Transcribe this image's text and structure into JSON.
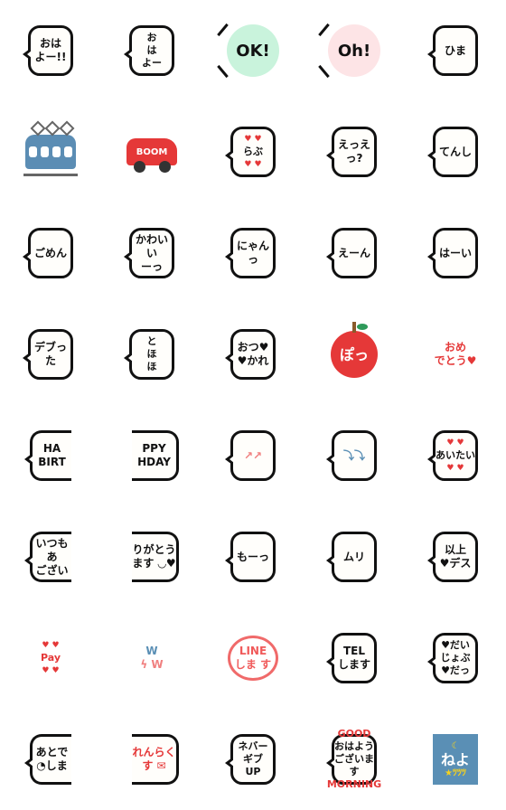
{
  "colors": {
    "ink": "#111111",
    "red": "#e53838",
    "pink": "#f08080",
    "blue": "#5a8fb5",
    "mint": "#c9f3dc",
    "blush": "#fde4e6",
    "yellow": "#f7d21e"
  },
  "emojis": [
    {
      "name": "ohayo-sun",
      "variant": "bubble",
      "lines": [
        "おは",
        "よー!!"
      ],
      "color": "#111111"
    },
    {
      "name": "ohayo-rooster",
      "variant": "bubble",
      "lines": [
        "お",
        "は",
        "よー"
      ],
      "color": "#111111"
    },
    {
      "name": "ok",
      "variant": "circle-green",
      "lines": [
        "OK!"
      ],
      "color": "#111111"
    },
    {
      "name": "oh",
      "variant": "circle-pink",
      "lines": [
        "Oh!"
      ],
      "color": "#111111"
    },
    {
      "name": "hima",
      "variant": "bubble",
      "lines": [
        "ひま"
      ],
      "color": "#111111"
    },
    {
      "name": "train",
      "variant": "train",
      "lines": [],
      "color": "#5a8fb5"
    },
    {
      "name": "car-boom",
      "variant": "car",
      "lines": [
        "BOOM"
      ],
      "color": "#ffffff"
    },
    {
      "name": "rabu",
      "variant": "bubble",
      "lines": [
        "♥ ♥",
        "らぶ",
        "♥ ♥"
      ],
      "color": "#111111"
    },
    {
      "name": "eee",
      "variant": "bubble",
      "lines": [
        "えっえっ?"
      ],
      "color": "#111111"
    },
    {
      "name": "tenshi",
      "variant": "bubble",
      "lines": [
        "てんし"
      ],
      "color": "#111111"
    },
    {
      "name": "gomen",
      "variant": "bubble",
      "lines": [
        "ごめん"
      ],
      "color": "#111111"
    },
    {
      "name": "kawaii",
      "variant": "bubble",
      "lines": [
        "かわいい",
        "ーっ"
      ],
      "color": "#111111"
    },
    {
      "name": "nyan",
      "variant": "bubble",
      "lines": [
        "にゃんっ"
      ],
      "color": "#111111"
    },
    {
      "name": "een",
      "variant": "bubble",
      "lines": [
        "えーん"
      ],
      "color": "#111111"
    },
    {
      "name": "hai",
      "variant": "bubble",
      "lines": [
        "はーい"
      ],
      "color": "#111111"
    },
    {
      "name": "debutta",
      "variant": "bubble",
      "lines": [
        "デブった"
      ],
      "color": "#111111"
    },
    {
      "name": "tohoho",
      "variant": "bubble",
      "lines": [
        "と",
        "ほ",
        "ほ"
      ],
      "color": "#111111"
    },
    {
      "name": "otsukare",
      "variant": "bubble",
      "lines": [
        "おつ♥",
        "♥かれ"
      ],
      "color": "#111111"
    },
    {
      "name": "po-apple",
      "variant": "apple",
      "lines": [
        "ぽっ"
      ],
      "color": "#ffffff"
    },
    {
      "name": "omedetou",
      "variant": "plain",
      "lines": [
        "おめ",
        "でとう♥"
      ],
      "color": "#e53838"
    },
    {
      "name": "happy-birthday-left",
      "variant": "cut-right",
      "lines": [
        "HA",
        "BIRT"
      ],
      "color": "#111111"
    },
    {
      "name": "happy-birthday-right",
      "variant": "cut-left",
      "lines": [
        "PPY",
        "HDAY"
      ],
      "color": "#111111"
    },
    {
      "name": "up-arrows",
      "variant": "bubble",
      "lines": [
        "↗↗"
      ],
      "color": "#f08080"
    },
    {
      "name": "down-arrows",
      "variant": "bubble",
      "lines": [
        "⤵⤵"
      ],
      "color": "#5a8fb5"
    },
    {
      "name": "aitai",
      "variant": "bubble",
      "lines": [
        "♥ ♥",
        "あいたい",
        "♥ ♥"
      ],
      "color": "#111111"
    },
    {
      "name": "itsumo-left",
      "variant": "cut-right",
      "lines": [
        "いつもあ",
        "ござい"
      ],
      "color": "#111111"
    },
    {
      "name": "itsumo-right",
      "variant": "cut-left",
      "lines": [
        "りがとう",
        "ます ◡♥"
      ],
      "color": "#111111"
    },
    {
      "name": "mou",
      "variant": "bubble",
      "lines": [
        "もーっ"
      ],
      "color": "#111111"
    },
    {
      "name": "muri",
      "variant": "bubble",
      "lines": [
        "ムリ"
      ],
      "color": "#111111"
    },
    {
      "name": "ijou-desu",
      "variant": "bubble",
      "lines": [
        "以上",
        "♥デス"
      ],
      "color": "#111111"
    },
    {
      "name": "pay",
      "variant": "plain",
      "lines": [
        "♥ ♥",
        "Pay",
        "♥ ♥"
      ],
      "color": "#e53838"
    },
    {
      "name": "www",
      "variant": "plain",
      "lines": [
        "W",
        "ϟ W"
      ],
      "color": "#5a8fb5"
    },
    {
      "name": "line-shimasu",
      "variant": "line-bubble",
      "lines": [
        "LINE",
        "しま す"
      ],
      "color": "#f05a5a"
    },
    {
      "name": "tel-shimasu",
      "variant": "bubble",
      "lines": [
        "TEL",
        "します"
      ],
      "color": "#111111"
    },
    {
      "name": "daijoubu",
      "variant": "bubble",
      "lines": [
        "♥だい",
        "じょぶ",
        "♥だっ"
      ],
      "color": "#111111"
    },
    {
      "name": "atode-left",
      "variant": "cut-right",
      "lines": [
        "あとで",
        "◔しま"
      ],
      "color": "#111111"
    },
    {
      "name": "atode-right",
      "variant": "cut-left",
      "lines": [
        "れんらく",
        "す ✉"
      ],
      "color": "#e53838"
    },
    {
      "name": "never-give-up",
      "variant": "bubble",
      "lines": [
        "ネバー",
        "ギブ",
        "UP"
      ],
      "color": "#111111"
    },
    {
      "name": "good-morning",
      "variant": "bubble",
      "lines": [
        "GOOD",
        "おはよう",
        "ございます",
        "MORNING"
      ],
      "color": "#111111"
    },
    {
      "name": "neyo",
      "variant": "blue",
      "lines": [
        "☾",
        "ねよ",
        "★ﾂﾂﾂ"
      ],
      "color": "#ffffff"
    }
  ]
}
